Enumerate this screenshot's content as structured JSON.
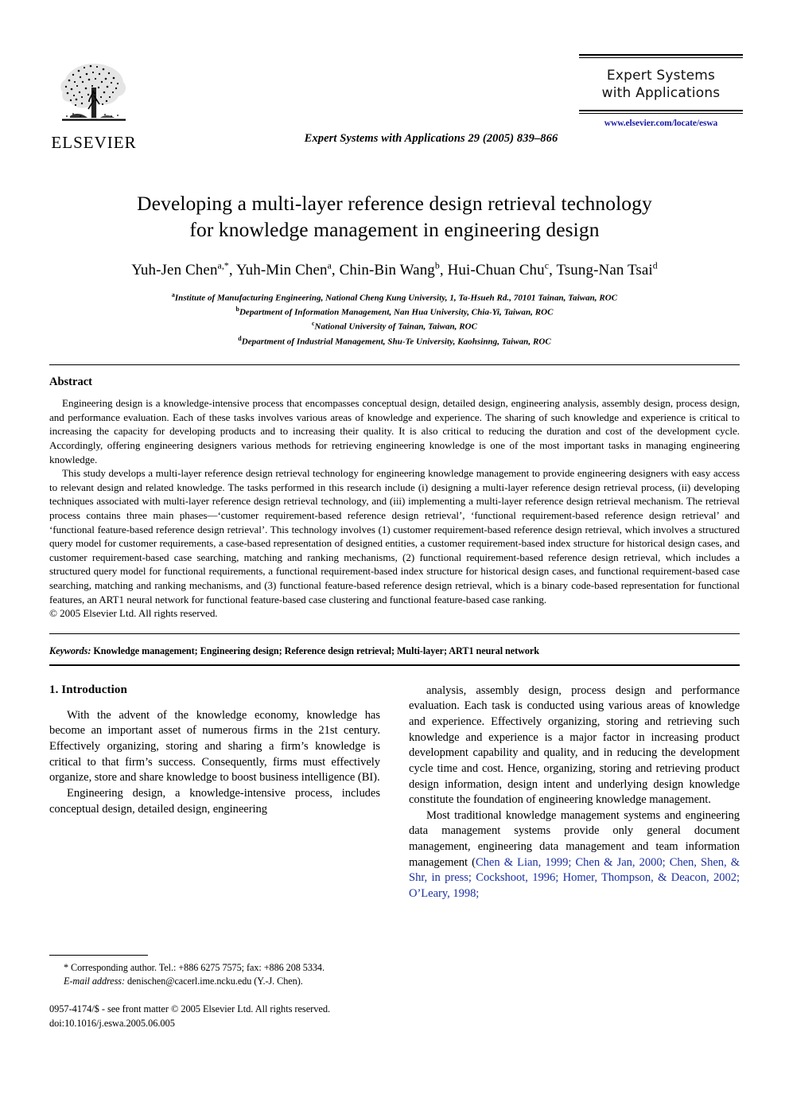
{
  "masthead": {
    "publisher_logo_text": "ELSEVIER",
    "publisher_logo_icon": "elsevier-tree-logo",
    "journal_citation": "Expert Systems with Applications 29 (2005) 839–866",
    "journal_badge_line1": "Expert Systems",
    "journal_badge_line2": "with Applications",
    "journal_url": "www.elsevier.com/locate/eswa"
  },
  "title_block": {
    "title_line1": "Developing a multi-layer reference design retrieval technology",
    "title_line2": "for knowledge management in engineering design",
    "authors": [
      {
        "name": "Yuh-Jen Chen",
        "sup": "a,*",
        "sep": ", "
      },
      {
        "name": "Yuh-Min Chen",
        "sup": "a",
        "sep": ", "
      },
      {
        "name": "Chin-Bin Wang",
        "sup": "b",
        "sep": ", "
      },
      {
        "name": "Hui-Chuan Chu",
        "sup": "c",
        "sep": ", "
      },
      {
        "name": "Tsung-Nan Tsai",
        "sup": "d",
        "sep": ""
      }
    ],
    "affiliations": [
      {
        "marker": "a",
        "text": "Institute of Manufacturing Engineering, National Cheng Kung University, 1, Ta-Hsueh Rd., 70101 Tainan, Taiwan, ROC"
      },
      {
        "marker": "b",
        "text": "Department of Information Management, Nan Hua University, Chia-Yi, Taiwan, ROC"
      },
      {
        "marker": "c",
        "text": "National University of Tainan, Taiwan, ROC"
      },
      {
        "marker": "d",
        "text": "Department of Industrial Management, Shu-Te University, Kaohsinng, Taiwan, ROC"
      }
    ]
  },
  "abstract": {
    "heading": "Abstract",
    "paragraph1": "Engineering design is a knowledge-intensive process that encompasses conceptual design, detailed design, engineering analysis, assembly design, process design, and performance evaluation. Each of these tasks involves various areas of knowledge and experience. The sharing of such knowledge and experience is critical to increasing the capacity for developing products and to increasing their quality. It is also critical to reducing the duration and cost of the development cycle. Accordingly, offering engineering designers various methods for retrieving engineering knowledge is one of the most important tasks in managing engineering knowledge.",
    "paragraph2": "This study develops a multi-layer reference design retrieval technology for engineering knowledge management to provide engineering designers with easy access to relevant design and related knowledge. The tasks performed in this research include (i) designing a multi-layer reference design retrieval process, (ii) developing techniques associated with multi-layer reference design retrieval technology, and (iii) implementing a multi-layer reference design retrieval mechanism. The retrieval process contains three main phases—‘customer requirement-based reference design retrieval’, ‘functional requirement-based reference design retrieval’ and ‘functional feature-based reference design retrieval’. This technology involves (1) customer requirement-based reference design retrieval, which involves a structured query model for customer requirements, a case-based representation of designed entities, a customer requirement-based index structure for historical design cases, and customer requirement-based case searching, matching and ranking mechanisms, (2) functional requirement-based reference design retrieval, which includes a structured query model for functional requirements, a functional requirement-based index structure for historical design cases, and functional requirement-based case searching, matching and ranking mechanisms, and (3) functional feature-based reference design retrieval, which is a binary code-based representation for functional features, an ART1 neural network for functional feature-based case clustering and functional feature-based case ranking.",
    "copyright": "© 2005 Elsevier Ltd. All rights reserved."
  },
  "keywords": {
    "label": "Keywords:",
    "text": " Knowledge management; Engineering design; Reference design retrieval; Multi-layer; ART1 neural network"
  },
  "body": {
    "left_column": {
      "section_heading": "1. Introduction",
      "paragraph1": "With the advent of the knowledge economy, knowledge has become an important asset of numerous firms in the 21st century. Effectively organizing, storing and sharing a firm’s knowledge is critical to that firm’s success. Consequently, firms must effectively organize, store and share knowledge to boost business intelligence (BI).",
      "paragraph2": "Engineering design, a knowledge-intensive process, includes conceptual design, detailed design, engineering"
    },
    "right_column": {
      "paragraph1": "analysis, assembly design, process design and performance evaluation. Each task is conducted using various areas of knowledge and experience. Effectively organizing, storing and retrieving such knowledge and experience is a major factor in increasing product development capability and quality, and in reducing the development cycle time and cost. Hence, organizing, storing and retrieving product design information, design intent and underlying design knowledge constitute the foundation of engineering knowledge management.",
      "paragraph2_pre": "Most traditional knowledge management systems and engineering data management systems provide only general document management, engineering data management and team information management (",
      "paragraph2_citations": "Chen & Lian, 1999; Chen & Jan, 2000; Chen, Shen, & Shr, in press; Cockshoot, 1996; Homer, Thompson, & Deacon, 2002; O’Leary, 1998;"
    }
  },
  "footnotes": {
    "corresponding_marker": "*",
    "corresponding_text": " Corresponding author. Tel.: +886 6275 7575; fax: +886 208 5334.",
    "email_label": "E-mail address:",
    "email_text": " denischen@cacerl.ime.ncku.edu (Y.-J. Chen).",
    "issn_line": "0957-4174/$ - see front matter © 2005 Elsevier Ltd. All rights reserved.",
    "doi_line": "doi:10.1016/j.eswa.2005.06.005"
  },
  "colors": {
    "link_blue": "#1a1aa8",
    "citation_blue": "#1a2f9e",
    "text_black": "#000000",
    "page_background": "#ffffff"
  }
}
